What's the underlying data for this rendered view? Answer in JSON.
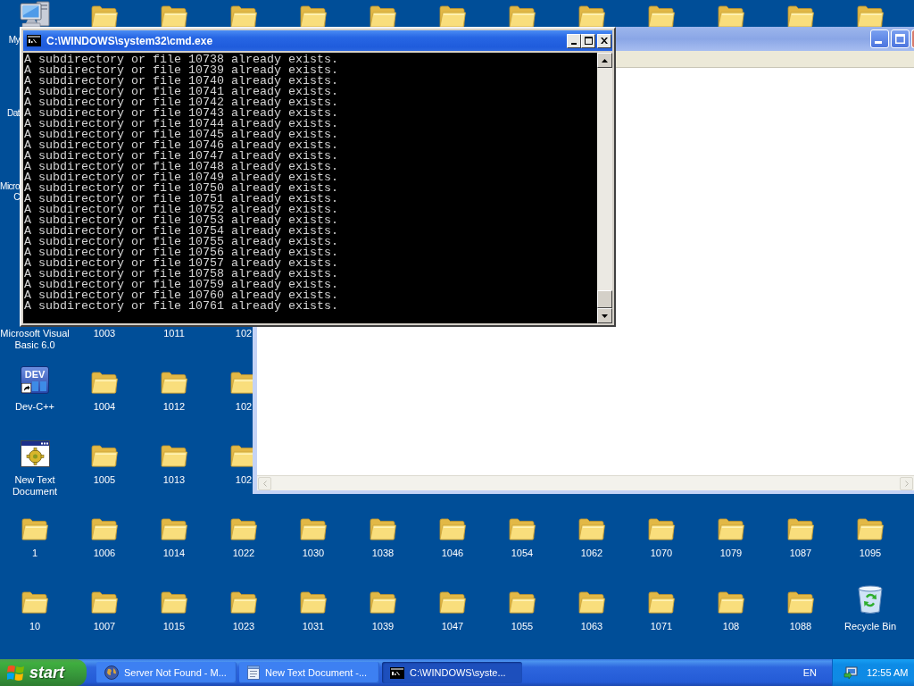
{
  "desktop": {
    "top_row": [
      {
        "kind": "computer",
        "lines": [
          "My"
        ]
      },
      {
        "kind": "folder"
      },
      {
        "kind": "folder"
      },
      {
        "kind": "folder"
      },
      {
        "kind": "folder"
      },
      {
        "kind": "folder"
      },
      {
        "kind": "folder"
      },
      {
        "kind": "folder"
      },
      {
        "kind": "folder"
      },
      {
        "kind": "folder"
      },
      {
        "kind": "folder"
      },
      {
        "kind": "folder"
      },
      {
        "kind": "folder"
      }
    ],
    "left_column": [
      {
        "lines": [
          "Dat"
        ]
      },
      {
        "lines": [
          "Micro",
          "C"
        ]
      }
    ],
    "middle_rows": [
      [
        {
          "label": "Microsoft Visual Basic 6.0"
        },
        {
          "label": "1003"
        },
        {
          "label": "1011"
        },
        {
          "label": "102"
        }
      ],
      [
        {
          "kind": "devcpp",
          "icon_text": "DEV",
          "label": "Dev-C++"
        },
        {
          "kind": "folder",
          "label": "1004"
        },
        {
          "kind": "folder",
          "label": "1012"
        },
        {
          "kind": "folder",
          "label": "102"
        }
      ],
      [
        {
          "kind": "app_window",
          "label": "New Text Document"
        },
        {
          "kind": "folder",
          "label": "1005"
        },
        {
          "kind": "folder",
          "label": "1013"
        },
        {
          "kind": "folder",
          "label": "102"
        }
      ]
    ],
    "bottom_rows": [
      [
        {
          "kind": "folder",
          "label": "1"
        },
        {
          "kind": "folder",
          "label": "1006"
        },
        {
          "kind": "folder",
          "label": "1014"
        },
        {
          "kind": "folder",
          "label": "1022"
        },
        {
          "kind": "folder",
          "label": "1030"
        },
        {
          "kind": "folder",
          "label": "1038"
        },
        {
          "kind": "folder",
          "label": "1046"
        },
        {
          "kind": "folder",
          "label": "1054"
        },
        {
          "kind": "folder",
          "label": "1062"
        },
        {
          "kind": "folder",
          "label": "1070"
        },
        {
          "kind": "folder",
          "label": "1079"
        },
        {
          "kind": "folder",
          "label": "1087"
        },
        {
          "kind": "folder",
          "label": "1095"
        }
      ],
      [
        {
          "kind": "folder",
          "label": "10"
        },
        {
          "kind": "folder",
          "label": "1007"
        },
        {
          "kind": "folder",
          "label": "1015"
        },
        {
          "kind": "folder",
          "label": "1023"
        },
        {
          "kind": "folder",
          "label": "1031"
        },
        {
          "kind": "folder",
          "label": "1039"
        },
        {
          "kind": "folder",
          "label": "1047"
        },
        {
          "kind": "folder",
          "label": "1055"
        },
        {
          "kind": "folder",
          "label": "1063"
        },
        {
          "kind": "folder",
          "label": "1071"
        },
        {
          "kind": "folder",
          "label": "108"
        },
        {
          "kind": "folder",
          "label": "1088"
        },
        {
          "kind": "recycle_bin",
          "label": "Recycle Bin"
        }
      ]
    ]
  },
  "console_window": {
    "title": "C:\\WINDOWS\\system32\\cmd.exe",
    "lines": [
      "A subdirectory or file 10738 already exists.",
      "A subdirectory or file 10739 already exists.",
      "A subdirectory or file 10740 already exists.",
      "A subdirectory or file 10741 already exists.",
      "A subdirectory or file 10742 already exists.",
      "A subdirectory or file 10743 already exists.",
      "A subdirectory or file 10744 already exists.",
      "A subdirectory or file 10745 already exists.",
      "A subdirectory or file 10746 already exists.",
      "A subdirectory or file 10747 already exists.",
      "A subdirectory or file 10748 already exists.",
      "A subdirectory or file 10749 already exists.",
      "A subdirectory or file 10750 already exists.",
      "A subdirectory or file 10751 already exists.",
      "A subdirectory or file 10752 already exists.",
      "A subdirectory or file 10753 already exists.",
      "A subdirectory or file 10754 already exists.",
      "A subdirectory or file 10755 already exists.",
      "A subdirectory or file 10756 already exists.",
      "A subdirectory or file 10757 already exists.",
      "A subdirectory or file 10758 already exists.",
      "A subdirectory or file 10759 already exists.",
      "A subdirectory or file 10760 already exists.",
      "A subdirectory or file 10761 already exists."
    ]
  },
  "taskbar": {
    "start": "start",
    "tasks": [
      {
        "kind": "browser",
        "label": "Server Not Found - M...",
        "selected": false
      },
      {
        "kind": "notepad",
        "label": "New Text Document -...",
        "selected": false
      },
      {
        "kind": "console",
        "label": "C:\\WINDOWS\\syste...",
        "selected": true
      }
    ],
    "language": "EN",
    "clock": "12:55 AM"
  }
}
